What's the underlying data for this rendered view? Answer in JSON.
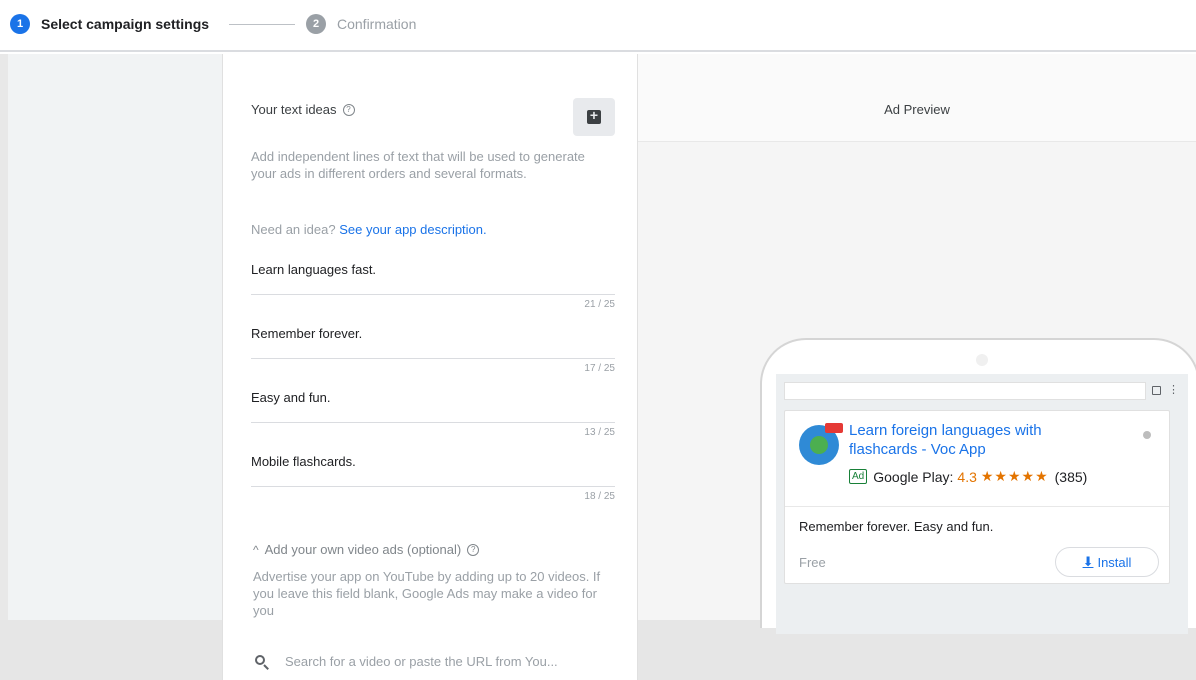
{
  "stepper": {
    "step1": {
      "number": "1",
      "label": "Select campaign settings"
    },
    "step2": {
      "number": "2",
      "label": "Confirmation"
    }
  },
  "text_ideas": {
    "title": "Your text ideas",
    "description": "Add independent lines of text that will be used to generate your ads in different orders and several formats.",
    "idea_prompt": "Need an idea?",
    "idea_link": "See your app description.",
    "fields": [
      {
        "value": "Learn languages fast.",
        "counter": "21 / 25"
      },
      {
        "value": "Remember forever.",
        "counter": "17 / 25"
      },
      {
        "value": "Easy and fun.",
        "counter": "13 / 25"
      },
      {
        "value": "Mobile flashcards.",
        "counter": "18 / 25"
      }
    ]
  },
  "video_ads": {
    "chevron": "^",
    "title": "Add your own video ads (optional)",
    "description": "Advertise your app on YouTube by adding up to 20 videos. If you leave this field blank, Google Ads may make a video for you",
    "search_placeholder": "Search for a video or paste the URL from You..."
  },
  "preview": {
    "title": "Ad Preview",
    "ad": {
      "headline": "Learn foreign languages with flashcards - Voc App",
      "badge": "Ad",
      "store": "Google Play:",
      "rating": "4.3",
      "stars": "★★★★★",
      "count": "(385)",
      "body": "Remember forever. Easy and fun.",
      "price": "Free",
      "install_label": "Install"
    }
  },
  "icons": {
    "help": "?",
    "download": "⬇",
    "menu": "⋮"
  },
  "colors": {
    "accent": "#1a73e8",
    "step_inactive": "#9aa0a6",
    "rating": "#e37400",
    "ad_badge": "#188038"
  }
}
